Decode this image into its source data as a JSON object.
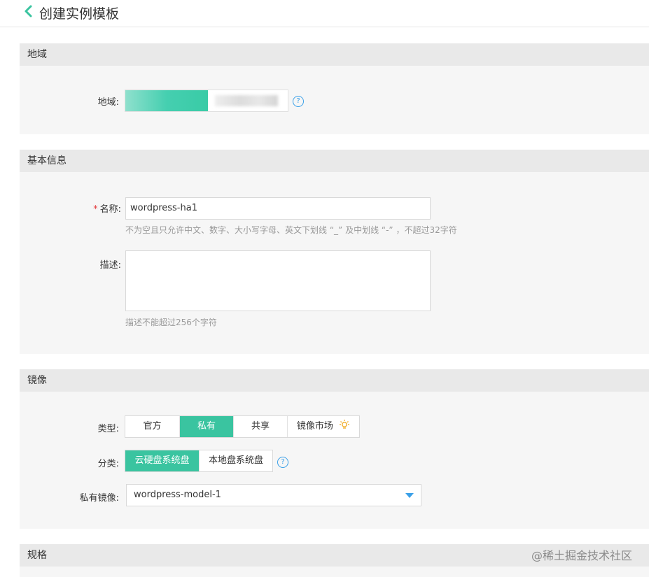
{
  "header": {
    "title": "创建实例模板"
  },
  "region_section": {
    "title": "地域",
    "label": "地域:"
  },
  "basic_section": {
    "title": "基本信息",
    "name_required_mark": "*",
    "name_label": "名称:",
    "name_value": "wordpress-ha1",
    "name_hint": "不为空且只允许中文、数字、大小写字母、英文下划线 “_” 及中划线 “-” ，不超过32字符",
    "desc_label": "描述:",
    "desc_value": "",
    "desc_hint": "描述不能超过256个字符"
  },
  "image_section": {
    "title": "镜像",
    "type_label": "类型:",
    "type_options": [
      "官方",
      "私有",
      "共享",
      "镜像市场"
    ],
    "type_selected": "私有",
    "category_label": "分类:",
    "category_options": [
      "云硬盘系统盘",
      "本地盘系统盘"
    ],
    "category_selected": "云硬盘系统盘",
    "private_label": "私有镜像:",
    "private_value": "wordpress-model-1"
  },
  "spec_section": {
    "title": "规格"
  },
  "watermark": "@稀土掘金技术社区",
  "colors": {
    "accent": "#3ac4a0",
    "link_blue": "#3aa0e8",
    "required": "#e4393c"
  },
  "icons": {
    "back": "chevron-left-icon",
    "help": "question-circle-icon",
    "market": "lightbulb-icon",
    "dropdown": "caret-down-icon"
  }
}
